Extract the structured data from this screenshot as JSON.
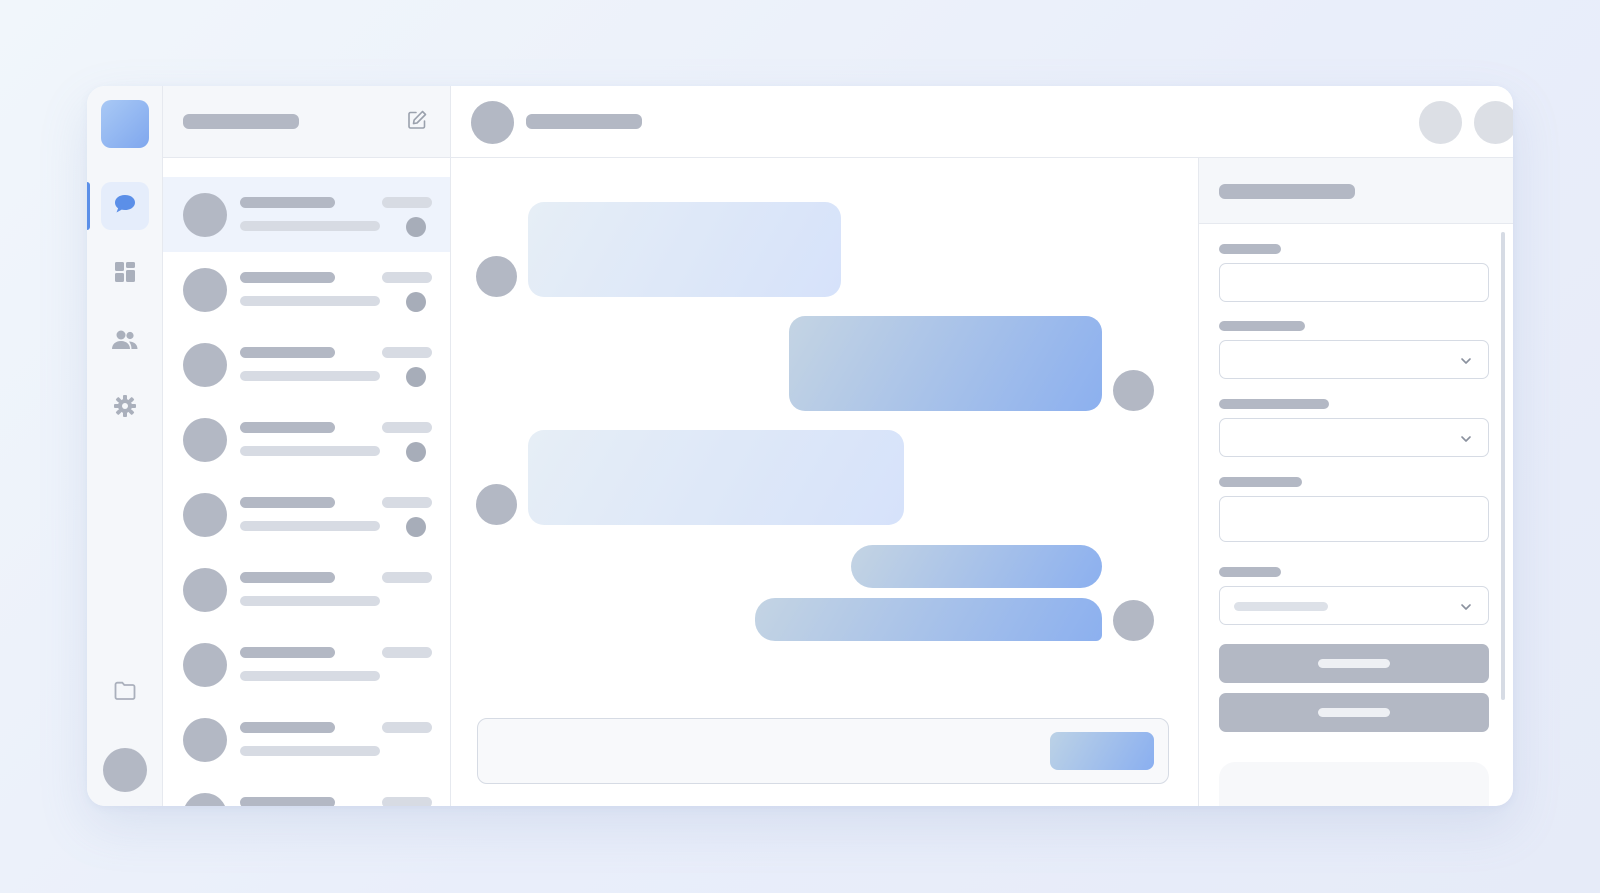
{
  "colors": {
    "accent": "#5b8fe8",
    "placeholder": "#b3b8c4",
    "placeholder_light": "#d7dbe3",
    "outgoing_bubble": "#8cb0ef",
    "incoming_bubble": "#d6e2fa"
  },
  "rail": {
    "items": [
      {
        "icon": "chat-bubble-icon",
        "active": true
      },
      {
        "icon": "dashboard-grid-icon",
        "active": false
      },
      {
        "icon": "users-icon",
        "active": false
      },
      {
        "icon": "gear-icon",
        "active": false
      }
    ],
    "bottom_icon": "folder-icon"
  },
  "conversations": {
    "compose_icon": "compose-icon",
    "items": [
      {
        "active": true,
        "unread": true
      },
      {
        "active": false,
        "unread": true
      },
      {
        "active": false,
        "unread": true
      },
      {
        "active": false,
        "unread": true
      },
      {
        "active": false,
        "unread": true
      },
      {
        "active": false,
        "unread": false
      },
      {
        "active": false,
        "unread": false
      },
      {
        "active": false,
        "unread": false
      },
      {
        "active": false,
        "unread": false
      }
    ]
  },
  "chat": {
    "messages": [
      {
        "direction": "incoming"
      },
      {
        "direction": "outgoing"
      },
      {
        "direction": "incoming"
      },
      {
        "direction": "outgoing"
      },
      {
        "direction": "outgoing"
      }
    ],
    "header_actions": [
      "call-action",
      "video-action",
      "info-action"
    ]
  },
  "panel": {
    "fields": [
      {
        "kind": "text"
      },
      {
        "kind": "select"
      },
      {
        "kind": "select"
      },
      {
        "kind": "textarea"
      },
      {
        "kind": "select",
        "has_value": true
      }
    ],
    "buttons": [
      "primary",
      "secondary"
    ]
  }
}
